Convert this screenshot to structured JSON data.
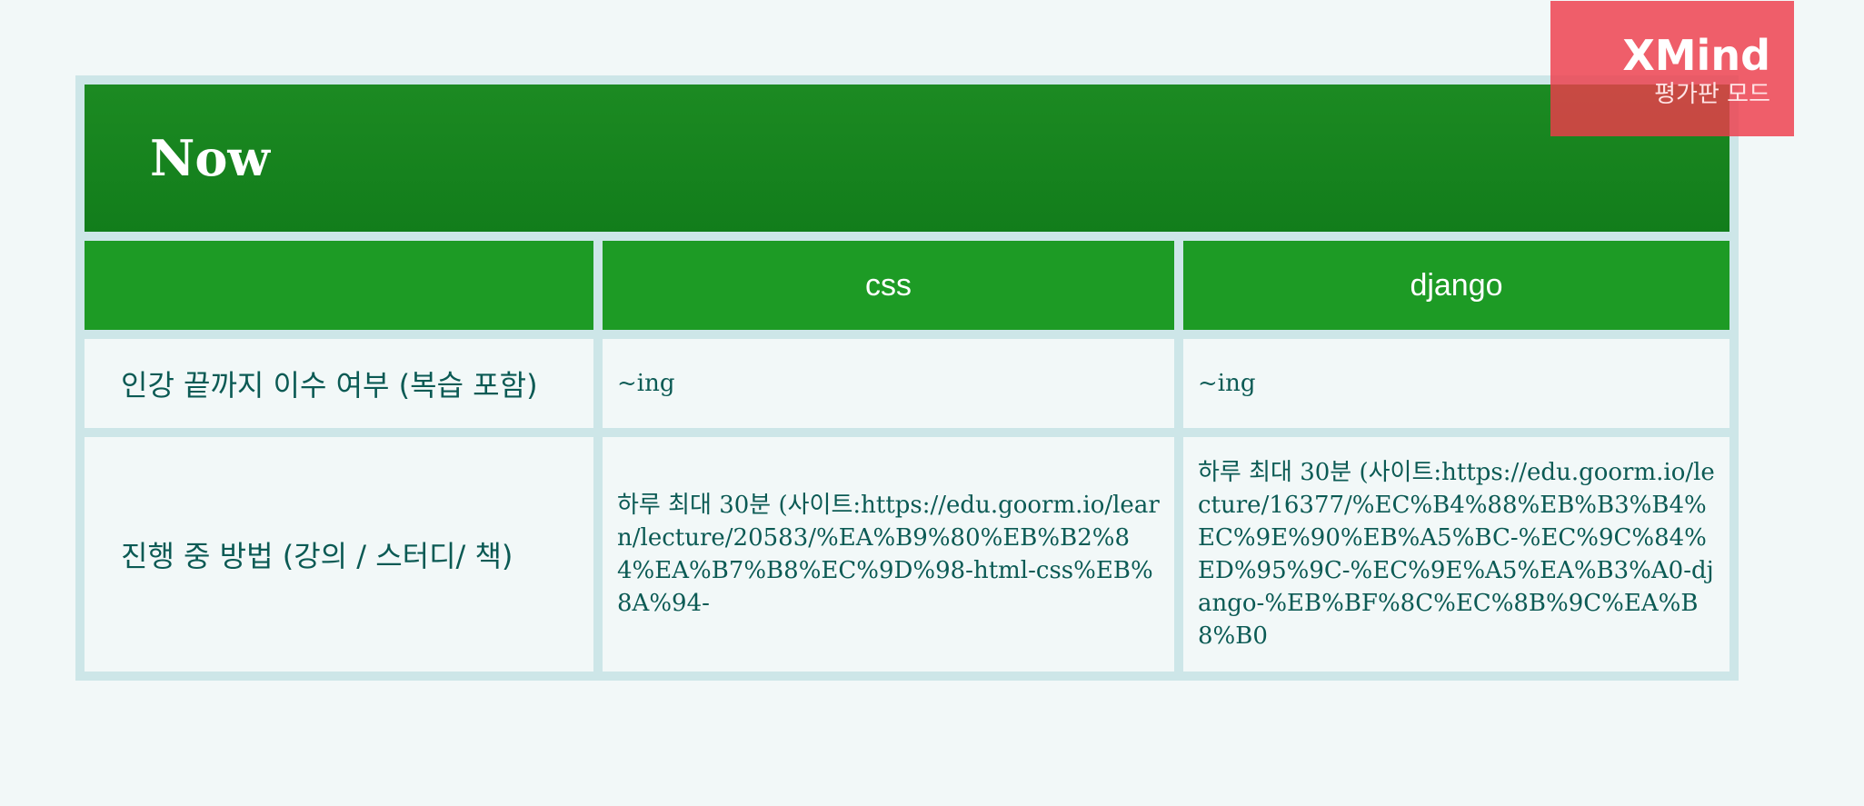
{
  "title": "Now",
  "columns": [
    "",
    "css",
    "django"
  ],
  "rows": [
    {
      "label": "인강 끝까지 이수 여부 (복습 포함)",
      "values": [
        "~ing",
        "~ing"
      ]
    },
    {
      "label": "진행 중 방법 (강의 / 스터디/ 책)",
      "values": [
        "하루 최대 30분 (사이트:https://edu.goorm.io/learn/lecture/20583/%EA%B9%80%EB%B2%84%EA%B7%B8%EC%9D%98-html-css%EB%8A%94-",
        "하루 최대 30분 (사이트:https://edu.goorm.io/lecture/16377/%EC%B4%88%EB%B3%B4%EC%9E%90%EB%A5%BC-%EC%9C%84%ED%95%9C-%EC%9E%A5%EA%B3%A0-django-%EB%BF%8C%EC%8B%9C%EA%B8%B0"
      ]
    }
  ],
  "watermark": {
    "logo": "XMind",
    "subtitle": "평가판 모드"
  },
  "colors": {
    "title_bg": "#15851d",
    "header_bg": "#1d9b25",
    "grid": "#cde6e8",
    "cell_bg": "#f2f8f8",
    "text": "#0b5a54",
    "watermark": "#ee3c4b"
  }
}
